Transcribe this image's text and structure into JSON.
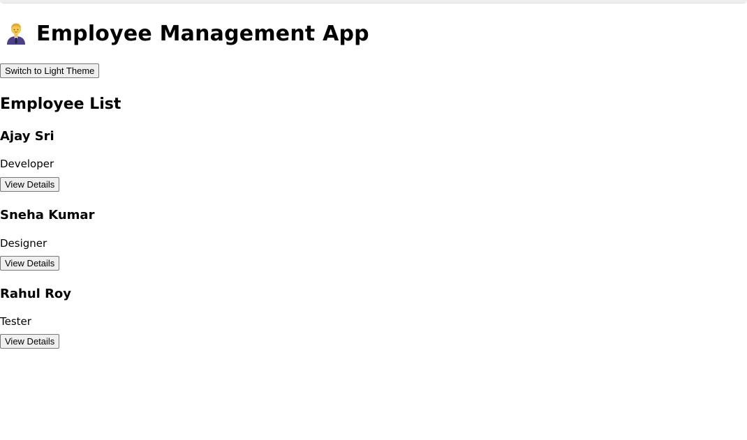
{
  "app": {
    "title": "Employee Management App",
    "theme_button_label": "Switch to Light Theme"
  },
  "list": {
    "heading": "Employee List",
    "employees": [
      {
        "name": "Ajay Sri",
        "role": "Developer",
        "button_label": "View Details"
      },
      {
        "name": "Sneha Kumar",
        "role": "Designer",
        "button_label": "View Details"
      },
      {
        "name": "Rahul Roy",
        "role": "Tester",
        "button_label": "View Details"
      }
    ]
  },
  "icons": {
    "header_icon": "person-in-suit-emoji-icon"
  }
}
